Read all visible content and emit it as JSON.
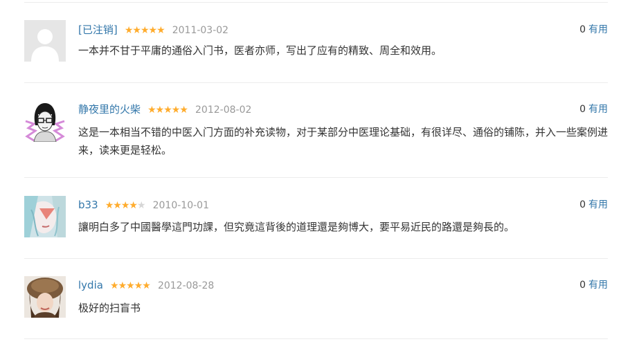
{
  "reviews": [
    {
      "user": "[已注销]",
      "rating": 5,
      "date": "2011-03-02",
      "useful_count": "0",
      "useful_label": "有用",
      "text": "一本并不甘于平庸的通俗入门书，医者亦师，写出了应有的精致、周全和效用。",
      "avatar": "default-user-avatar"
    },
    {
      "user": "静夜里的火柴",
      "rating": 5,
      "date": "2012-08-02",
      "useful_count": "0",
      "useful_label": "有用",
      "text": "这是一本相当不错的中医入门方面的补充读物，对于某部分中医理论基础，有很详尽、通俗的铺陈，并入一些案例进来，读来更是轻松。",
      "avatar": "sketch-girl-avatar"
    },
    {
      "user": "b33",
      "rating": 4,
      "date": "2010-10-01",
      "useful_count": "0",
      "useful_label": "有用",
      "text": "讓明白多了中國醫學這門功課，但究竟這背後的道理還是夠博大，要平易近民的路還是夠長的。",
      "avatar": "painted-face-avatar"
    },
    {
      "user": "lydia",
      "rating": 5,
      "date": "2012-08-28",
      "useful_count": "0",
      "useful_label": "有用",
      "text": "极好的扫盲书",
      "avatar": "fur-hat-photo-avatar"
    }
  ],
  "star_icon": "★",
  "colors": {
    "link": "#3377aa",
    "star": "#ffac2d",
    "star_empty": "#d6d6d6",
    "date": "#999999",
    "text": "#333333"
  }
}
